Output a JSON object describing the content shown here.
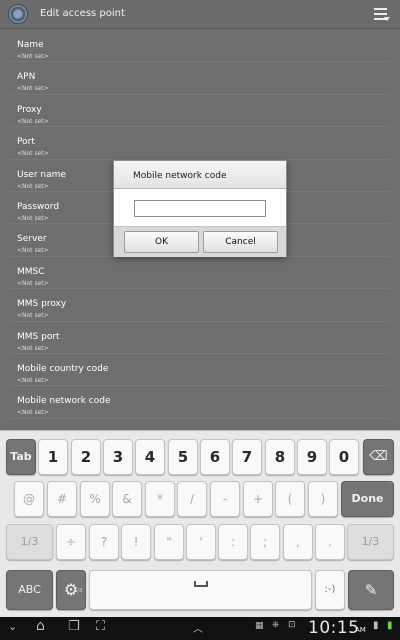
{
  "app_bar": {
    "title": "Edit access point"
  },
  "settings": [
    {
      "label": "Name",
      "value": "<Not set>"
    },
    {
      "label": "APN",
      "value": "<Not set>"
    },
    {
      "label": "Proxy",
      "value": "<Not set>"
    },
    {
      "label": "Port",
      "value": "<Not set>"
    },
    {
      "label": "User name",
      "value": "<Not set>"
    },
    {
      "label": "Password",
      "value": "<Not set>"
    },
    {
      "label": "Server",
      "value": "<Not set>"
    },
    {
      "label": "MMSC",
      "value": "<Not set>"
    },
    {
      "label": "MMS proxy",
      "value": "<Not set>"
    },
    {
      "label": "MMS port",
      "value": "<Not set>"
    },
    {
      "label": "Mobile country code",
      "value": "<Not set>"
    },
    {
      "label": "Mobile network code",
      "value": "<Not set>"
    }
  ],
  "dialog": {
    "title": "Mobile network code",
    "input_value": "",
    "ok_label": "OK",
    "cancel_label": "Cancel"
  },
  "keyboard": {
    "row1": [
      "Tab",
      "1",
      "2",
      "3",
      "4",
      "5",
      "6",
      "7",
      "8",
      "9",
      "0",
      "⌫"
    ],
    "row2": [
      "@",
      "#",
      "%",
      "&",
      "*",
      "/",
      "-",
      "+",
      "(",
      ")",
      "Done"
    ],
    "row3": [
      "1/3",
      "÷",
      "?",
      "!",
      "\"",
      "'",
      ":",
      ";",
      ",",
      ".",
      "1/3"
    ],
    "row4": [
      "ABC",
      "⚙",
      "␣",
      ":-)",
      "✎"
    ],
    "row4_sub": "1/3"
  },
  "system_bar": {
    "time": "10:15",
    "ampm": "AM"
  },
  "colors": {
    "dim_background": "#6e6e6e",
    "keyboard": "#e8e8e8",
    "system_bar": "#111111"
  }
}
